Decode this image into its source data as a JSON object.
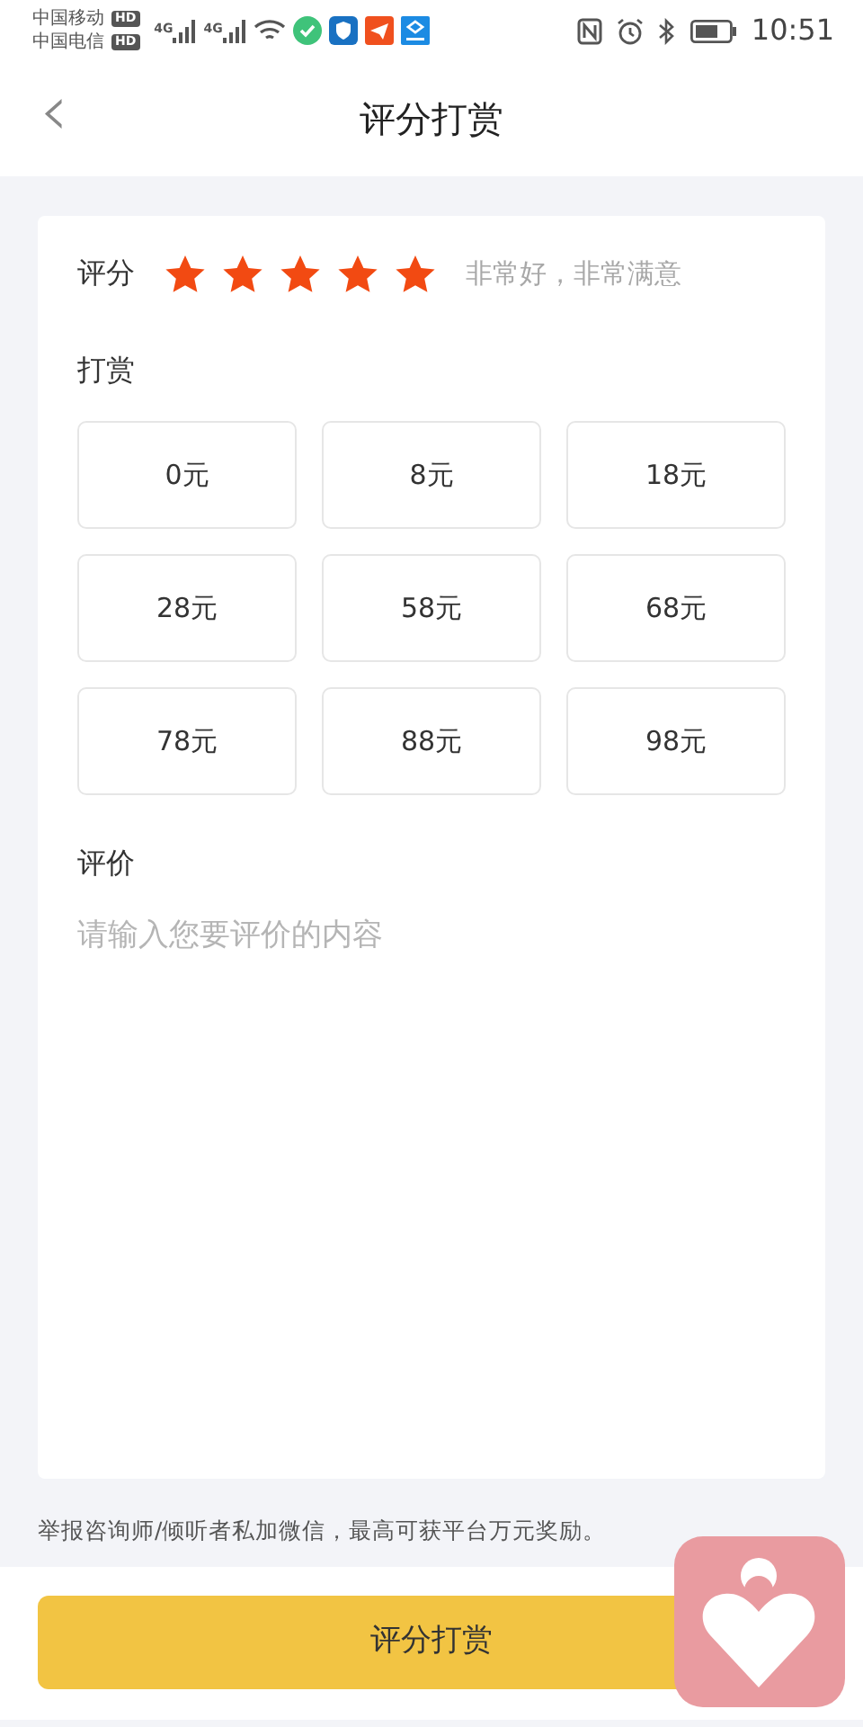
{
  "status_bar": {
    "carriers": [
      {
        "name": "中国移动",
        "badge": "HD"
      },
      {
        "name": "中国电信",
        "badge": "HD"
      }
    ],
    "networks": [
      "4G",
      "4G"
    ],
    "time": "10:51"
  },
  "header": {
    "back": "‹",
    "title": "评分打赏"
  },
  "rating": {
    "label": "评分",
    "stars": 5,
    "caption": "非常好，非常满意"
  },
  "reward": {
    "label": "打赏",
    "amounts": [
      {
        "text": "0元",
        "selected": false
      },
      {
        "text": "8元",
        "selected": false
      },
      {
        "text": "18元",
        "selected": false
      },
      {
        "text": "28元",
        "selected": false
      },
      {
        "text": "58元",
        "selected": false
      },
      {
        "text": "68元",
        "selected": false
      },
      {
        "text": "78元",
        "selected": false
      },
      {
        "text": "88元",
        "selected": false
      },
      {
        "text": "98元",
        "selected": false
      }
    ]
  },
  "review": {
    "label": "评价",
    "placeholder": "请输入您要评价的内容"
  },
  "notice": "举报咨询师/倾听者私加微信，最高可获平台万元奖励。",
  "submit": "评分打赏"
}
